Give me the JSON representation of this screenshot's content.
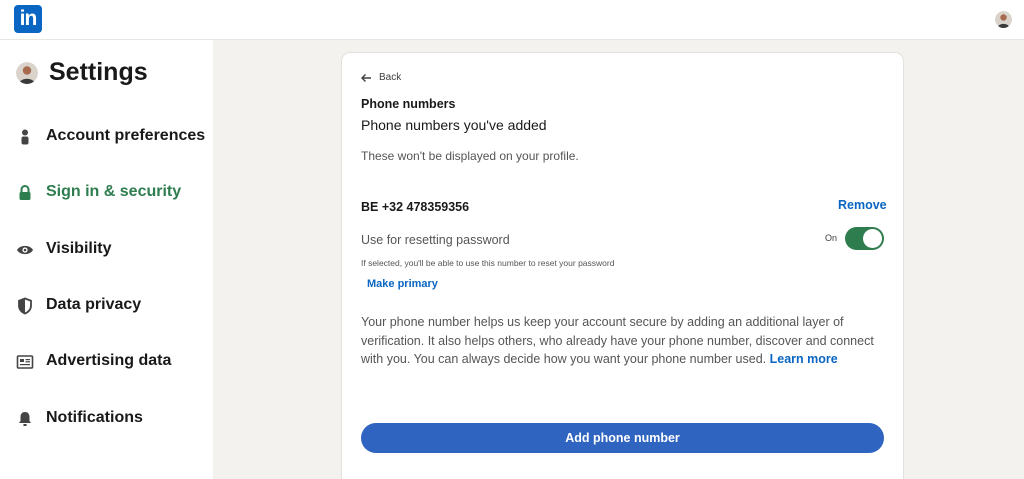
{
  "brand": {
    "logo_text": "in",
    "color": "#0a66c2",
    "accent_green": "#2e7d4f"
  },
  "sidebar": {
    "title": "Settings",
    "items": [
      {
        "label": "Account preferences",
        "icon": "person-icon",
        "active": false
      },
      {
        "label": "Sign in & security",
        "icon": "lock-icon",
        "active": true
      },
      {
        "label": "Visibility",
        "icon": "eye-icon",
        "active": false
      },
      {
        "label": "Data privacy",
        "icon": "shield-icon",
        "active": false
      },
      {
        "label": "Advertising data",
        "icon": "newspaper-icon",
        "active": false
      },
      {
        "label": "Notifications",
        "icon": "bell-icon",
        "active": false
      }
    ]
  },
  "main": {
    "back_label": "Back",
    "section_title": "Phone numbers",
    "subtitle": "Phone numbers you've added",
    "note": "These won't be displayed on your profile.",
    "phone": {
      "number": "BE +32 478359356",
      "remove_label": "Remove",
      "reset_label": "Use for resetting password",
      "toggle_state": "On",
      "toggle_on": true,
      "helper": "If selected, you'll be able to use this number to reset your password",
      "make_primary_label": "Make primary"
    },
    "info_text": "Your phone number helps us keep your account secure by adding an additional layer of verification. It also helps others, who already have your phone number, discover and connect with you. You can always decide how you want your phone number used.",
    "learn_more_label": "Learn more",
    "add_button_label": "Add phone number"
  }
}
